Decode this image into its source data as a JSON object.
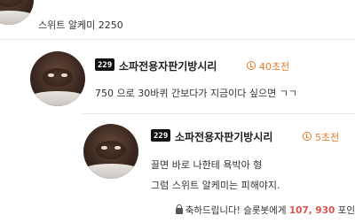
{
  "comments": [
    {
      "text": "스위트 알케미 2250"
    },
    {
      "badge": "229",
      "nickname": "소파전용자판기방시리",
      "time": "40초전",
      "text": "750 으로 30바퀴 간보다가 지금이다 싶으면 ㄱㄱ"
    },
    {
      "badge": "229",
      "nickname": "소파전용자판기방시리",
      "time": "5초전",
      "lines": [
        "끌면 바로 나한테 욕박아 형",
        "그럼 스위트 알케미는 피해야지."
      ]
    }
  ],
  "footer": {
    "prefix": "축하드립니다! 슬롯봇에게 ",
    "amount": "107, 930",
    "suffix": " 포인"
  },
  "colors": {
    "time": "#e07b2c",
    "amount": "#d9534f"
  }
}
